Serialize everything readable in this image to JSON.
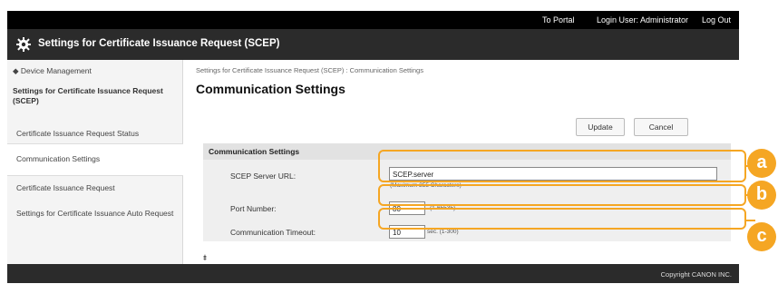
{
  "topbar": {
    "portal": "To Portal",
    "login": "Login User: Administrator",
    "logout": "Log Out"
  },
  "header": {
    "title": "Settings for Certificate Issuance Request (SCEP)",
    "icon": "gear-icon"
  },
  "sidebar": {
    "device_mgmt": "◆ Device Management",
    "section": "Settings for Certificate Issuance Request (SCEP)",
    "items": [
      {
        "label": "Certificate Issuance Request Status"
      },
      {
        "label": "Communication Settings"
      },
      {
        "label": "Certificate Issuance Request"
      },
      {
        "label": "Settings for Certificate Issuance Auto Request"
      }
    ]
  },
  "main": {
    "breadcrumb": "Settings for Certificate Issuance Request (SCEP) : Communication Settings",
    "title": "Communication Settings",
    "update_label": "Update",
    "cancel_label": "Cancel",
    "panel_title": "Communication Settings",
    "scep_label": "SCEP Server URL:",
    "scep_value": "SCEP.server",
    "scep_hint": "(Maximum 255 Characters)",
    "port_label": "Port Number:",
    "port_value": "80",
    "port_hint": "(1-65535)",
    "timeout_label": "Communication Timeout:",
    "timeout_value": "10",
    "timeout_hint": "sec. (1-300)",
    "scroll_top": "⯒"
  },
  "callouts": {
    "a": "a",
    "b": "b",
    "c": "c",
    "color": "#f5a623"
  },
  "footer": {
    "copyright": "Copyright CANON INC."
  }
}
